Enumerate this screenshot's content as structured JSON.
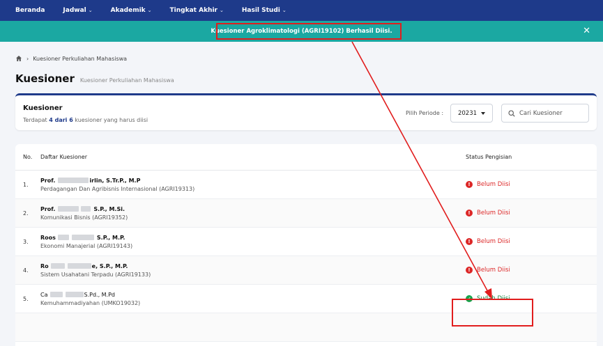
{
  "nav": {
    "items": [
      {
        "label": "Beranda",
        "caret": ""
      },
      {
        "label": "Jadwal",
        "caret": "⌄"
      },
      {
        "label": "Akademik",
        "caret": "⌄"
      },
      {
        "label": "Tingkat Akhir",
        "caret": "⌄"
      },
      {
        "label": "Hasil Studi",
        "caret": "⌄"
      }
    ]
  },
  "alert": {
    "message": "Kuesioner Agroklimatologi (AGRI19102) Berhasil Diisi.",
    "close": "✕"
  },
  "breadcrumb": {
    "separator": "›",
    "current": "Kuesioner Perkuliahan Mahasiswa"
  },
  "page": {
    "title": "Kuesioner",
    "subtitle": "Kuesioner Perkuliahan Mahasiswa"
  },
  "card": {
    "title": "Kuesioner",
    "summary_prefix": "Terdapat ",
    "summary_count": "4 dari 6",
    "summary_suffix": " kuesioner yang harus diisi",
    "period_label": "Pilih Periode :",
    "period_value": "20231",
    "search_placeholder": "Cari Kuesioner"
  },
  "table": {
    "headers": {
      "no": "No.",
      "name": "Daftar Kuesioner",
      "status": "Status Pengisian"
    },
    "rows": [
      {
        "no": "1.",
        "lecturer_pre": "Prof.",
        "lecturer_post": "irlin, S.Tr.P., M.P",
        "course": "Perdagangan Dan Agribisnis Internasional (AGRI19313)",
        "status": "Belum Diisi",
        "state": "belum"
      },
      {
        "no": "2.",
        "lecturer_pre": "Prof.",
        "lecturer_post": "S.P., M.Si.",
        "course": "Komunikasi Bisnis (AGRI19352)",
        "status": "Belum Diisi",
        "state": "belum"
      },
      {
        "no": "3.",
        "lecturer_pre": "Roos",
        "lecturer_post": "S.P., M.P.",
        "course": "Ekonomi Manajerial (AGRI19143)",
        "status": "Belum Diisi",
        "state": "belum"
      },
      {
        "no": "4.",
        "lecturer_pre": "Ro",
        "lecturer_post": "e, S.P., M.P.",
        "course": "Sistem Usahatani Terpadu (AGRI19133)",
        "status": "Belum Diisi",
        "state": "belum"
      },
      {
        "no": "5.",
        "lecturer_pre": "Ca",
        "lecturer_post": "S.Pd., M.Pd",
        "course": "Kemuhammadiyahan (UMKO19032)",
        "status": "Sudah Diisi",
        "state": "sudah"
      }
    ]
  },
  "colors": {
    "nav": "#1e3a8a",
    "alert": "#1ba8a2",
    "annotation": "#e11d1d",
    "belum": "#dc2626",
    "sudah": "#16a34a"
  }
}
